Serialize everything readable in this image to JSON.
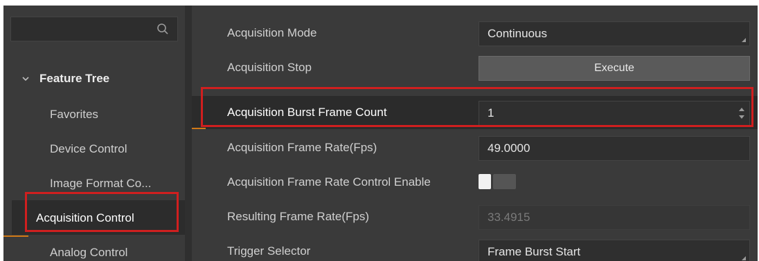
{
  "search": {
    "placeholder": "",
    "icon": "search-icon"
  },
  "tree": {
    "header_label": "Feature Tree",
    "items": [
      {
        "label": "Favorites"
      },
      {
        "label": "Device Control"
      },
      {
        "label": "Image Format Co..."
      },
      {
        "label": "Acquisition Control",
        "active": true
      },
      {
        "label": "Analog Control"
      }
    ]
  },
  "properties": [
    {
      "name": "Acquisition Mode",
      "value": "Continuous",
      "kind": "dropdown"
    },
    {
      "name": "Acquisition Stop",
      "value": "Execute",
      "kind": "button"
    },
    {
      "name": "Acquisition Burst Frame Count",
      "value": "1",
      "kind": "spinbox",
      "selected": true
    },
    {
      "name": "Acquisition Frame Rate(Fps)",
      "value": "49.0000",
      "kind": "text"
    },
    {
      "name": "Acquisition Frame Rate Control Enable",
      "value": "",
      "kind": "toggle"
    },
    {
      "name": "Resulting Frame Rate(Fps)",
      "value": "33.4915",
      "kind": "readonly"
    },
    {
      "name": "Trigger Selector",
      "value": "Frame Burst Start",
      "kind": "dropdown"
    }
  ],
  "colors": {
    "highlight": "#d01f1f",
    "accent": "#d17a17",
    "panel_bg": "#3a3a3a"
  }
}
